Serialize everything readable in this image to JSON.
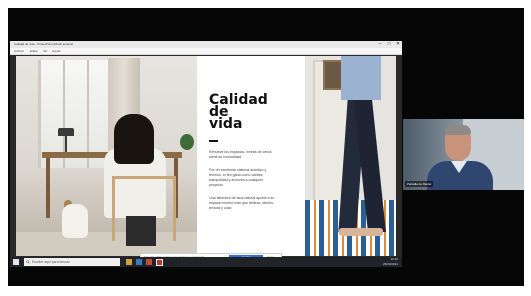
{
  "app": {
    "title": "Calidad de vida - PowerPoint (Modo lectura)",
    "menu": [
      "Archivo",
      "Editar",
      "Ver",
      "Ayuda"
    ],
    "window_controls": [
      "–",
      "□",
      "✕"
    ]
  },
  "slide": {
    "title_lines": [
      "Calidad",
      "de",
      "vida"
    ],
    "paragraphs": [
      "Renueve los espacios, invirtia de cerca, sienti su comodidad.",
      "Por un excelente sistema acústico y térmico, lo feo gana como calidez, tranquilidad y armonía a cualquier proyecto.",
      "Una alfombra de lana natural aporta a su espacio mucho más que belleza, diseño, textura y color."
    ]
  },
  "status_bar": {
    "text": "Este sitio utiliza cookies para mejorar su experiencia",
    "accept_label": "Aceptar",
    "link_label": "Cerrar"
  },
  "taskbar": {
    "search_placeholder": "Escribe aquí para buscar",
    "time": "10:42",
    "date": "26/04/2021"
  },
  "speaker": {
    "name": "Pantalla de Daniel"
  },
  "colors": {
    "accent": "#2f6fd6",
    "taskbar": "#202428",
    "meeting_bg": "#060606"
  }
}
